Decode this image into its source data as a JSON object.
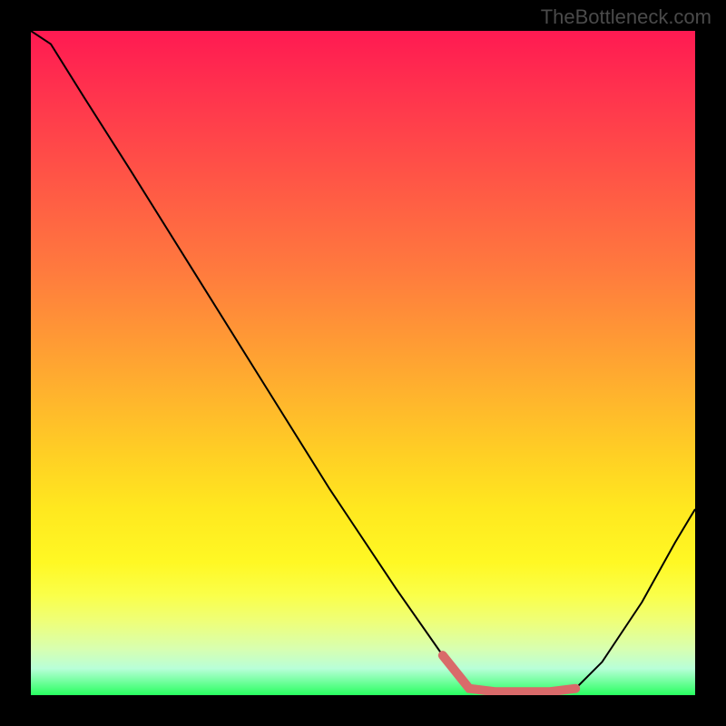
{
  "watermark": "TheBottleneck.com",
  "chart_data": {
    "type": "line",
    "title": "",
    "xlabel": "",
    "ylabel": "",
    "xlim": [
      0,
      100
    ],
    "ylim": [
      0,
      100
    ],
    "series": [
      {
        "name": "bottleneck-curve",
        "x": [
          0,
          3,
          8,
          15,
          25,
          35,
          45,
          55,
          62,
          66,
          70,
          74,
          78,
          82,
          86,
          92,
          97,
          100
        ],
        "values": [
          100,
          98,
          90,
          79,
          63,
          47,
          31,
          16,
          6,
          1,
          0.5,
          0.5,
          0.5,
          1,
          5,
          14,
          23,
          28
        ]
      },
      {
        "name": "bottleneck-highlight-segment",
        "x": [
          62,
          66,
          70,
          74,
          78,
          82
        ],
        "values": [
          6,
          1,
          0.5,
          0.5,
          0.5,
          1
        ]
      }
    ],
    "highlight_color": "#d96a6a",
    "curve_color": "#000000"
  }
}
